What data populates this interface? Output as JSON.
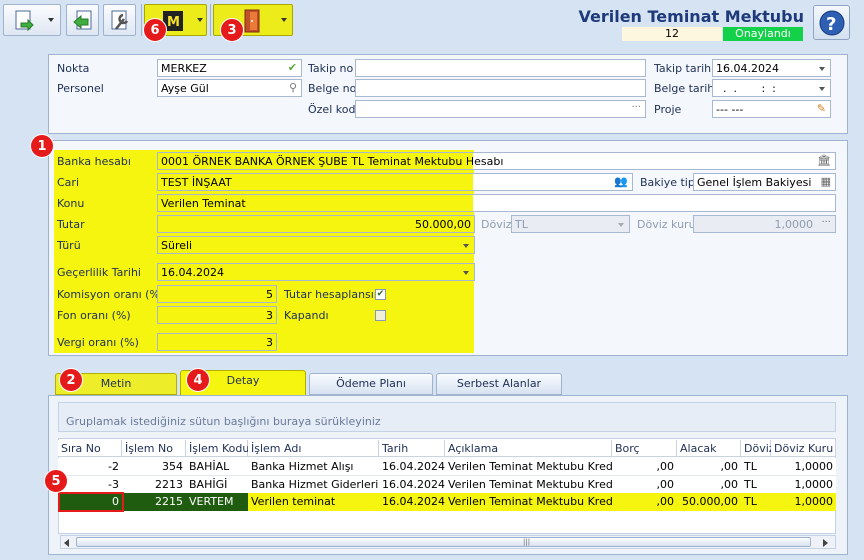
{
  "title": "Verilen Teminat Mektubu",
  "record_number": "12",
  "status": "Onaylandı",
  "help_icon": "question-icon",
  "badges": [
    "1",
    "2",
    "3",
    "4",
    "5",
    "6"
  ],
  "top": {
    "nokta_label": "Nokta",
    "nokta_value": "MERKEZ",
    "personel_label": "Personel",
    "personel_value": "Ayşe Gül",
    "takip_no_label": "Takip no",
    "takip_no_value": "",
    "belge_no_label": "Belge no",
    "belge_no_value": "",
    "ozel_kod_label": "Özel kod",
    "ozel_kod_value": "",
    "takip_tarihi_label": "Takip tarihi",
    "takip_tarihi_value": "16.04.2024",
    "belge_tarihi_label": "Belge tarihi",
    "belge_tarihi_value": "  .  .       :  :",
    "proje_label": "Proje",
    "proje_value": "--- ---"
  },
  "mid": {
    "banka_label": "Banka hesabı",
    "banka_value": "0001 ÖRNEK BANKA ÖRNEK ŞUBE TL Teminat Mektubu Hesabı",
    "cari_label": "Cari",
    "cari_value": "TEST İNŞAAT",
    "bakiye_label": "Bakiye tipi",
    "bakiye_value": "Genel İşlem Bakiyesi",
    "konu_label": "Konu",
    "konu_value": "Verilen Teminat",
    "tutar_label": "Tutar",
    "tutar_value": "50.000,00",
    "doviz_label": "Döviz",
    "doviz_value": "TL",
    "doviz_kuru_label": "Döviz kuru",
    "doviz_kuru_value": "1,0000",
    "turu_label": "Türü",
    "turu_value": "Süreli",
    "gecerlilik_label": "Geçerlilik Tarihi",
    "gecerlilik_value": "16.04.2024",
    "komisyon_label": "Komisyon oranı (%)",
    "komisyon_value": "5",
    "fon_label": "Fon oranı (%)",
    "fon_value": "3",
    "vergi_label": "Vergi oranı (%)",
    "vergi_value": "3",
    "tutar_hesap_label": "Tutar hesaplansın",
    "tutar_hesap_checked": "✔",
    "kapandi_label": "Kapandı",
    "kapandi_checked": ""
  },
  "tabs": [
    "Metin",
    "Detay",
    "Ödeme Planı",
    "Serbest Alanlar"
  ],
  "grid": {
    "group_hint": "Gruplamak istediğiniz sütun başlığını buraya sürükleyiniz",
    "columns": [
      "Sıra No",
      "İşlem No",
      "İşlem Kodu",
      "İşlem Adı",
      "Tarih",
      "Açıklama",
      "Borç",
      "Alacak",
      "Döviz",
      "Döviz Kuru"
    ],
    "rows": [
      [
        "-2",
        "354",
        "BAHİAL",
        "Banka Hizmet Alışı",
        "16.04.2024",
        "Verilen Teminat Mektubu KrediNo:",
        ",00",
        ",00",
        "TL",
        "1,0000"
      ],
      [
        "-3",
        "2213",
        "BAHİGİ",
        "Banka Hizmet Giderleri",
        "16.04.2024",
        "Verilen Teminat Mektubu KrediNo:",
        ",00",
        ",00",
        "TL",
        "1,0000"
      ],
      [
        "0",
        "2215",
        "VERTEM",
        "Verilen teminat",
        "16.04.2024",
        "Verilen Teminat Mektubu KrediNo:",
        ",00",
        "50.000,00",
        "TL",
        "1,0000"
      ]
    ]
  }
}
